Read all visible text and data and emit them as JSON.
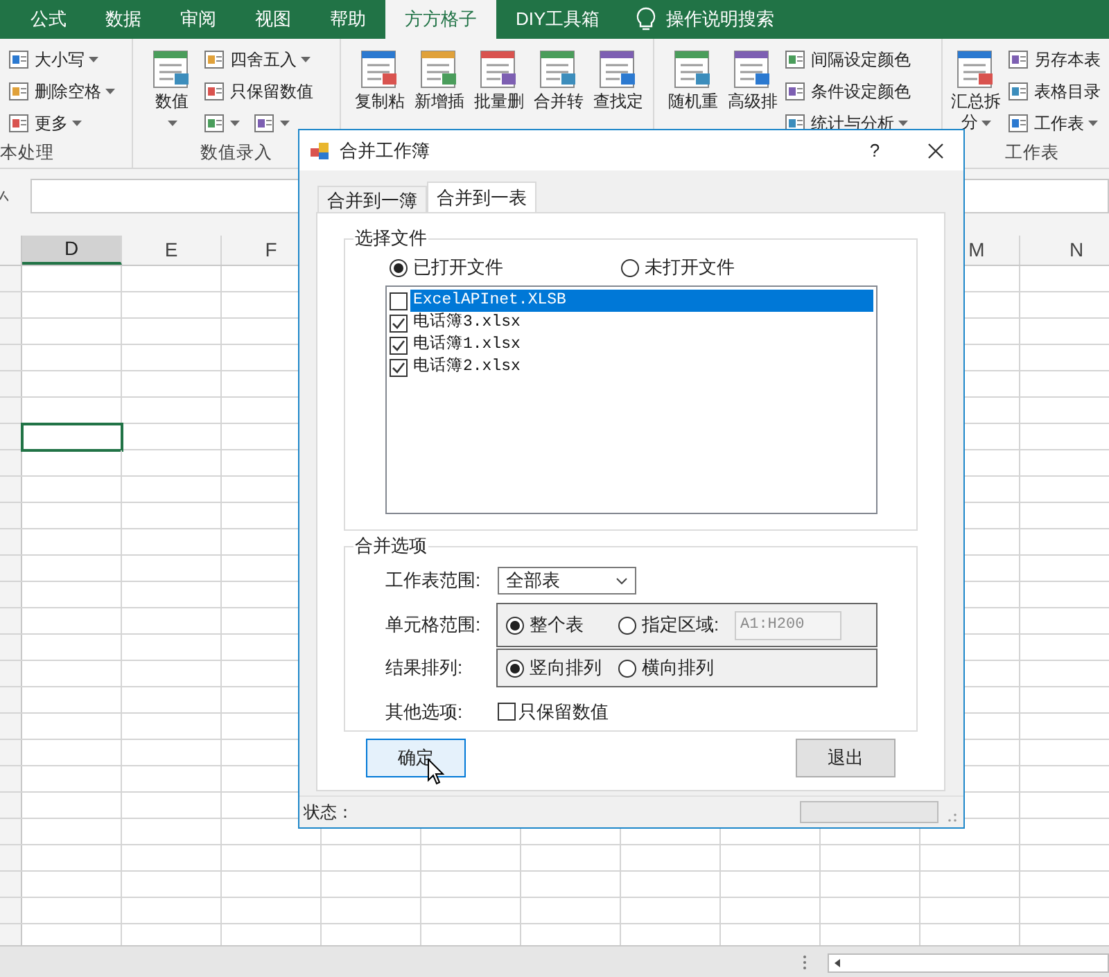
{
  "ribbon_tabs": [
    {
      "label": "公式",
      "selected": false
    },
    {
      "label": "数据",
      "selected": false
    },
    {
      "label": "审阅",
      "selected": false
    },
    {
      "label": "视图",
      "selected": false
    },
    {
      "label": "帮助",
      "selected": false
    },
    {
      "label": "方方格子",
      "selected": true
    },
    {
      "label": "DIY工具箱",
      "selected": false
    }
  ],
  "tell_me": "操作说明搜索",
  "ribbon_groups": [
    {
      "label": "本处理",
      "rows": [
        [
          {
            "label": "大小写",
            "dropdown": true
          }
        ],
        [
          {
            "label": "删除空格",
            "dropdown": true
          }
        ],
        [
          {
            "label": "更多",
            "dropdown": true
          }
        ]
      ]
    },
    {
      "label": "数值录入",
      "large": [
        {
          "lines": [
            "数值"
          ],
          "dropdown": true
        }
      ],
      "rows": [
        [
          {
            "label": "四舍五入",
            "dropdown": true
          }
        ],
        [
          {
            "label": "只保留数值"
          }
        ],
        [
          {
            "dropdown": true
          },
          {
            "dropdown": true
          }
        ]
      ]
    },
    {
      "large": [
        {
          "lines": [
            "复制粘"
          ]
        },
        {
          "lines": [
            "新增插"
          ]
        },
        {
          "lines": [
            "批量删"
          ]
        },
        {
          "lines": [
            "合并转"
          ]
        },
        {
          "lines": [
            "查找定"
          ]
        }
      ]
    },
    {
      "large": [
        {
          "lines": [
            "随机重"
          ]
        },
        {
          "lines": [
            "高级排"
          ]
        }
      ],
      "rows": [
        [
          {
            "label": "间隔设定颜色"
          }
        ],
        [
          {
            "label": "条件设定颜色"
          }
        ],
        [
          {
            "label": "统计与分析",
            "dropdown": true
          }
        ]
      ]
    },
    {
      "label": "工作表",
      "large": [
        {
          "lines": [
            "汇总拆",
            "分"
          ],
          "dropdown": true
        }
      ],
      "rows": [
        [
          {
            "label": "另存本表"
          }
        ],
        [
          {
            "label": "表格目录"
          }
        ],
        [
          {
            "label": "工作表",
            "dropdown": true
          }
        ]
      ]
    }
  ],
  "columns": [
    {
      "label": "D",
      "selected": true
    },
    {
      "label": "E",
      "selected": false
    },
    {
      "label": "F",
      "selected": false
    },
    {
      "label": "M",
      "selected": false
    },
    {
      "label": "N",
      "selected": false
    }
  ],
  "dialog": {
    "title": "合并工作簿",
    "help": "?",
    "tabs": [
      {
        "label": "合并到一簿",
        "selected": false
      },
      {
        "label": "合并到一表",
        "selected": true
      }
    ],
    "files_group": {
      "title": "选择文件",
      "sources": [
        {
          "label": "已打开文件",
          "selected": true
        },
        {
          "label": "未打开文件",
          "selected": false
        }
      ],
      "files": [
        {
          "name": "ExcelAPInet.XLSB",
          "checked": false,
          "selected": true
        },
        {
          "name": "电话簿3.xlsx",
          "checked": true,
          "selected": false
        },
        {
          "name": "电话簿1.xlsx",
          "checked": true,
          "selected": false
        },
        {
          "name": "电话簿2.xlsx",
          "checked": true,
          "selected": false
        }
      ]
    },
    "options_group": {
      "title": "合并选项",
      "sheet_range": {
        "label": "工作表范围:",
        "value": "全部表"
      },
      "cell_range": {
        "label": "单元格范围:",
        "options": [
          {
            "label": "整个表",
            "selected": true
          },
          {
            "label": "指定区域:",
            "selected": false
          }
        ],
        "range_value": "A1:H200"
      },
      "result_order": {
        "label": "结果排列:",
        "options": [
          {
            "label": "竖向排列",
            "selected": true
          },
          {
            "label": "横向排列",
            "selected": false
          }
        ]
      },
      "other": {
        "label": "其他选项:",
        "checkbox": {
          "label": "只保留数值",
          "checked": false
        }
      }
    },
    "buttons": [
      {
        "label": "确定",
        "highlighted": true
      },
      {
        "label": "退出",
        "highlighted": false
      }
    ],
    "status_label": "状态：",
    "progress": {
      "level": 0
    }
  }
}
